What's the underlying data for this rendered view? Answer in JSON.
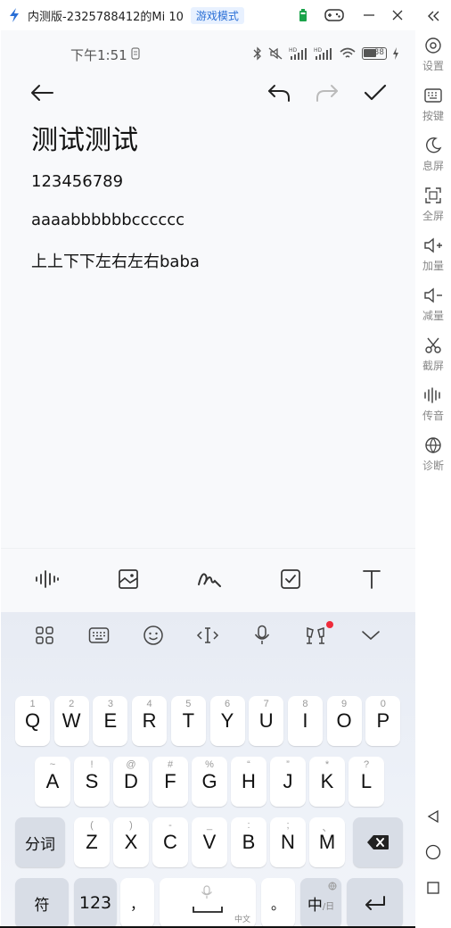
{
  "window": {
    "title": "内测版-2325788412的Mi 10",
    "mode_badge": "游戏模式"
  },
  "status_bar": {
    "time": "下午1:51",
    "battery": "88"
  },
  "note": {
    "title": "测试测试",
    "lines": [
      "123456789",
      "aaaabbbbbbcccccc",
      "上上下下左右左右baba"
    ]
  },
  "keyboard": {
    "rows": [
      [
        {
          "label": "Q",
          "hint": "1"
        },
        {
          "label": "W",
          "hint": "2"
        },
        {
          "label": "E",
          "hint": "3"
        },
        {
          "label": "R",
          "hint": "4"
        },
        {
          "label": "T",
          "hint": "5"
        },
        {
          "label": "Y",
          "hint": "6"
        },
        {
          "label": "U",
          "hint": "7"
        },
        {
          "label": "I",
          "hint": "8"
        },
        {
          "label": "O",
          "hint": "9"
        },
        {
          "label": "P",
          "hint": "0"
        }
      ],
      [
        {
          "label": "A",
          "hint": "~"
        },
        {
          "label": "S",
          "hint": "!"
        },
        {
          "label": "D",
          "hint": "@"
        },
        {
          "label": "F",
          "hint": "#"
        },
        {
          "label": "G",
          "hint": "%"
        },
        {
          "label": "H",
          "hint": "“"
        },
        {
          "label": "J",
          "hint": "”"
        },
        {
          "label": "K",
          "hint": "*"
        },
        {
          "label": "L",
          "hint": "?"
        }
      ],
      [
        {
          "label": "Z",
          "hint": "("
        },
        {
          "label": "X",
          "hint": ")"
        },
        {
          "label": "C",
          "hint": "-"
        },
        {
          "label": "V",
          "hint": "_"
        },
        {
          "label": "B",
          "hint": ":"
        },
        {
          "label": "N",
          "hint": ";"
        },
        {
          "label": "M",
          "hint": "、"
        }
      ]
    ],
    "fenci": "分词",
    "symbol": "符",
    "num": "123",
    "comma": "，",
    "space_note": "中文",
    "period": "。",
    "lang_main": "中",
    "lang_alt": "/日"
  },
  "sidebar": {
    "items": [
      {
        "label": "设置",
        "icon": "settings-icon"
      },
      {
        "label": "按键",
        "icon": "keyboard-icon"
      },
      {
        "label": "息屏",
        "icon": "moon-icon"
      },
      {
        "label": "全屏",
        "icon": "fullscreen-icon"
      },
      {
        "label": "加量",
        "icon": "volume-up-icon"
      },
      {
        "label": "减量",
        "icon": "volume-down-icon"
      },
      {
        "label": "截屏",
        "icon": "scissors-icon"
      },
      {
        "label": "传音",
        "icon": "audio-wave-icon"
      },
      {
        "label": "诊断",
        "icon": "globe-icon"
      }
    ]
  },
  "colors": {
    "accent": "#2a6fd6",
    "notification_dot": "#ef2b3b",
    "keyboard_bg": "#e9edf5"
  }
}
